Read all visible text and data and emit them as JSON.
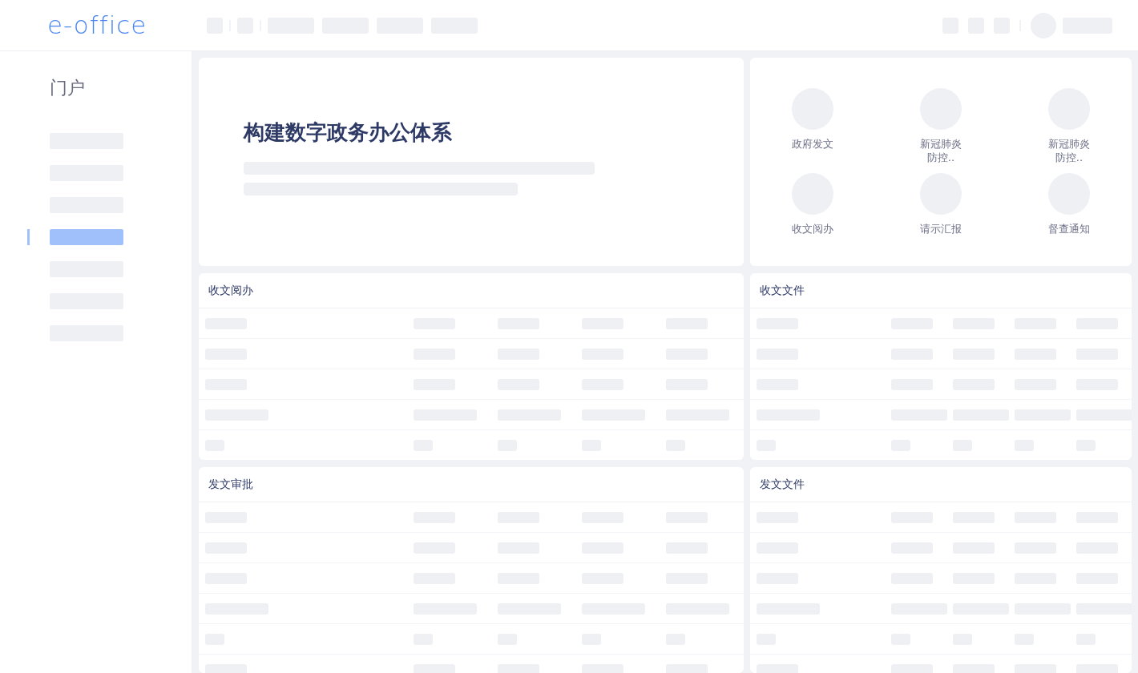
{
  "logo": "e-office",
  "sidebar": {
    "title": "门户",
    "items": [
      {
        "selected": false
      },
      {
        "selected": false
      },
      {
        "selected": false
      },
      {
        "selected": true
      },
      {
        "selected": false
      },
      {
        "selected": false
      },
      {
        "selected": false
      }
    ]
  },
  "hero": {
    "title": "构建数字政务办公体系"
  },
  "shortcuts": [
    {
      "label": "政府发文"
    },
    {
      "label": "新冠肺炎防控.."
    },
    {
      "label": "新冠肺炎防控.."
    },
    {
      "label": "收文阅办"
    },
    {
      "label": "请示汇报"
    },
    {
      "label": "督查通知"
    }
  ],
  "panels": [
    {
      "title": "收文阅办"
    },
    {
      "title": "收文文件"
    },
    {
      "title": "发文审批"
    },
    {
      "title": "发文文件"
    }
  ]
}
